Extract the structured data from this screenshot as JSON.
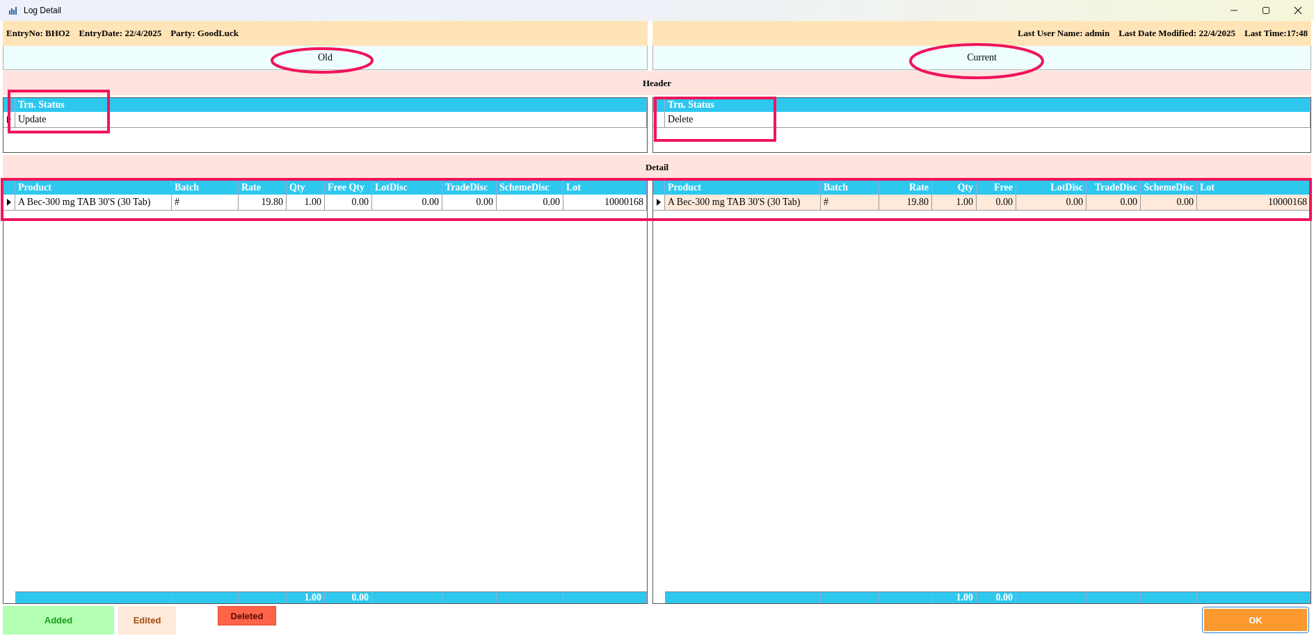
{
  "window": {
    "title": "Log Detail"
  },
  "info": {
    "left": [
      "EntryNo: BHO2",
      "EntryDate: 22/4/2025",
      "Party: GoodLuck"
    ],
    "right": [
      "Last User Name: admin",
      "Last Date Modified: 22/4/2025",
      "Last Time:17:48"
    ]
  },
  "header_band": "Header",
  "detail_band": "Detail",
  "sides": [
    {
      "title": "Old",
      "header_grid": {
        "columns": [
          "Trn. Status"
        ],
        "rows": [
          {
            "current": true,
            "cells": [
              "Update"
            ]
          }
        ]
      },
      "detail_grid": {
        "columns": [
          {
            "label": "Product"
          },
          {
            "label": "Batch"
          },
          {
            "label": "Rate"
          },
          {
            "label": "Qty",
            "total": "1.00"
          },
          {
            "label": "Free Qty",
            "total": "0.00"
          },
          {
            "label": "LotDisc"
          },
          {
            "label": "TradeDisc"
          },
          {
            "label": "SchemeDisc"
          },
          {
            "label": "Lot"
          }
        ],
        "rows": [
          {
            "current": true,
            "edited": false,
            "cells": [
              "A Bec-300 mg TAB 30'S (30 Tab)",
              "#",
              "19.80",
              "1.00",
              "0.00",
              "0.00",
              "0.00",
              "0.00",
              "10000168"
            ]
          }
        ]
      }
    },
    {
      "title": "Current",
      "header_grid": {
        "columns": [
          "Trn. Status"
        ],
        "rows": [
          {
            "current": false,
            "cells": [
              "Delete"
            ]
          }
        ]
      },
      "detail_grid": {
        "columns": [
          {
            "label": "Product"
          },
          {
            "label": "Batch"
          },
          {
            "label": "Rate"
          },
          {
            "label": "Qty",
            "total": "1.00"
          },
          {
            "label": "Free",
            "total": "0.00"
          },
          {
            "label": "LotDisc"
          },
          {
            "label": "TradeDisc"
          },
          {
            "label": "SchemeDisc"
          },
          {
            "label": "Lot"
          }
        ],
        "rows": [
          {
            "current": true,
            "edited": true,
            "cells": [
              "A Bec-300 mg TAB 30'S (30 Tab)",
              "#",
              "19.80",
              "1.00",
              "0.00",
              "0.00",
              "0.00",
              "0.00",
              "10000168"
            ]
          }
        ]
      }
    }
  ],
  "legend": [
    {
      "kind": "added",
      "label": "Added",
      "color": "#b3ffb3"
    },
    {
      "kind": "edited",
      "label": "Edited",
      "color": "#ffe9da"
    },
    {
      "kind": "deleted",
      "label": "Deleted",
      "color": "#ff634a"
    }
  ],
  "buttons": [
    "OK"
  ]
}
